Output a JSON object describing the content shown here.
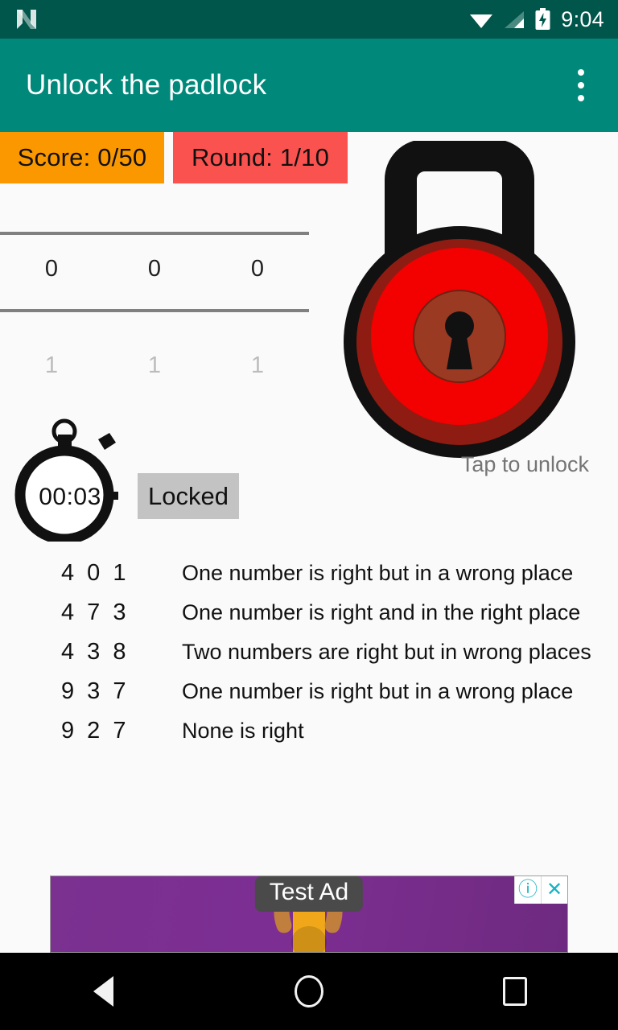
{
  "status_bar": {
    "time": "9:04",
    "icons": [
      "n-logo-icon",
      "wifi-icon",
      "cellular-signal-icon",
      "battery-charging-icon"
    ],
    "background": "#00564b"
  },
  "app_bar": {
    "title": "Unlock the padlock",
    "overflow_menu": "overflow-menu-icon",
    "background": "#00897b",
    "title_color": "#ffffff"
  },
  "game": {
    "score_label": "Score: 0/50",
    "score_color": "#fb9800",
    "round_label": "Round: 1/10",
    "round_color": "#f9524f",
    "picker": {
      "selected": [
        "0",
        "0",
        "0"
      ],
      "next": [
        "1",
        "1",
        "1"
      ]
    },
    "timer": "00:03",
    "lock_status": "Locked",
    "lock_status_color": "#c3c3c3",
    "padlock": {
      "state": "locked",
      "body_color": "#f30000",
      "shadow_color": "#8e1c12",
      "keyhole_plate_color": "#9b3a23",
      "outline_color": "#111111",
      "caption": "Tap to unlock"
    }
  },
  "hints": [
    {
      "code": "4 0 1",
      "text": "One number is right but in a wrong place"
    },
    {
      "code": "4 7 3",
      "text": "One number is right and in the right place"
    },
    {
      "code": "4 3 8",
      "text": "Two numbers are right but in wrong places"
    },
    {
      "code": "9 3 7",
      "text": "One number is right but in a wrong place"
    },
    {
      "code": "9 2 7",
      "text": "None is right"
    }
  ],
  "ad": {
    "label": "Test Ad",
    "background": "#7b2d8e",
    "info_icon": "ad-info-icon",
    "info_glyph": "ⓘ",
    "close_icon": "ad-close-icon",
    "close_glyph": "✕"
  },
  "nav_bar": {
    "back": "back-nav-icon",
    "home": "home-nav-icon",
    "recents": "recents-nav-icon"
  }
}
